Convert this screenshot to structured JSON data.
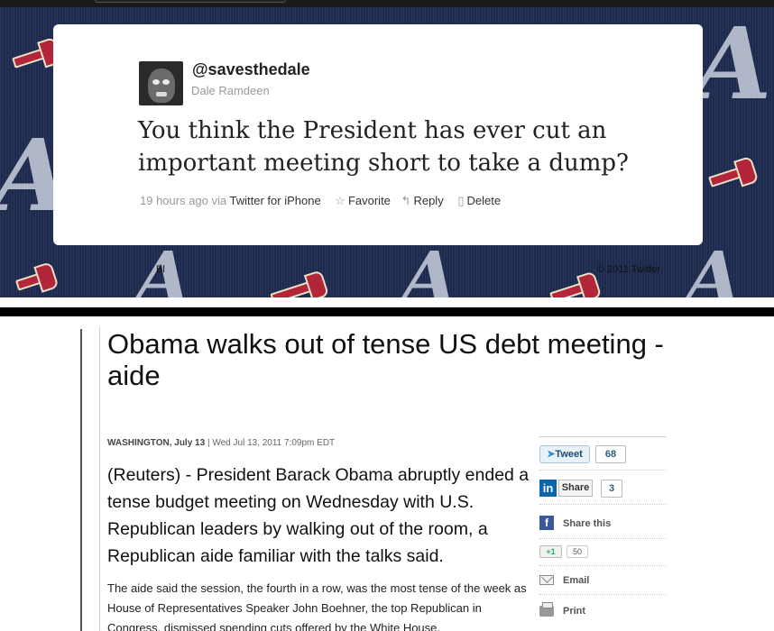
{
  "tweet": {
    "handle": "@savesthedale",
    "name": "Dale Ramdeen",
    "text": "You think the President has ever cut an important meeting short to take a dump?",
    "time": "19 hours ago via",
    "client": "Twitter for iPhone",
    "actions": {
      "favorite": "Favorite",
      "reply": "Reply",
      "delete": "Delete"
    },
    "icons": {
      "favorite": "star-icon",
      "reply": "reply-arrow-icon",
      "delete": "trash-icon"
    }
  },
  "twitter_footer": {
    "left": "Bl",
    "right": "© 2011 Twitter"
  },
  "background": {
    "logo_letter": "A",
    "primary_color": "#1d2a4d",
    "accent_color": "#b3263a"
  },
  "article": {
    "title": "Obama walks out of tense US debt meeting - aide",
    "dateline_city": "WASHINGTON, July 13",
    "dateline_rest": " | Wed Jul 13, 2011 7:09pm EDT",
    "lead": "(Reuters) - President Barack Obama abruptly ended a tense budget meeting on Wednesday with U.S. Republican leaders by walking out of the room, a Republican aide familiar with the talks said.",
    "body": "The aide said the session, the fourth in a row, was the most tense of the week as House of Representatives Speaker John Boehner, the top Republican in Congress, dismissed spending cuts offered by the White House."
  },
  "share": {
    "tweet_label": "Tweet",
    "tweet_count": "68",
    "linkedin_label": "Share",
    "linkedin_count": "3",
    "facebook_label": "Share this",
    "gplus_label": "+1",
    "gplus_count": "50",
    "email_label": "Email",
    "print_label": "Print"
  }
}
